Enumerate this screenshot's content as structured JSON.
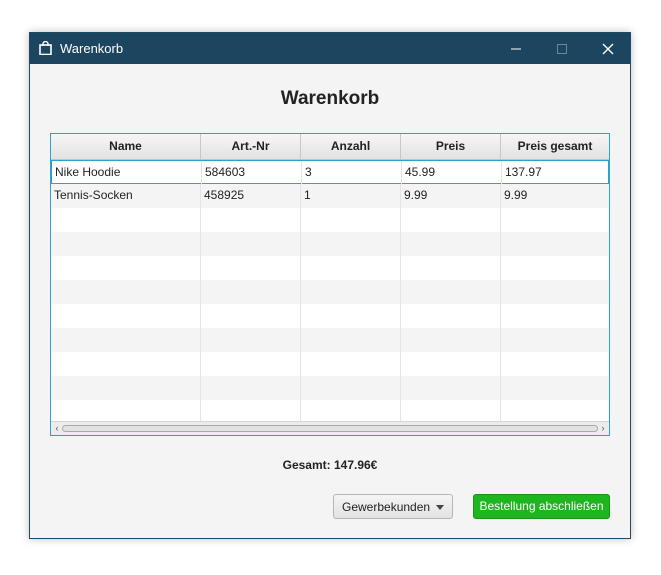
{
  "window": {
    "title": "Warenkorb",
    "app_icon": "shopping-bag-icon"
  },
  "heading": "Warenkorb",
  "table": {
    "columns": [
      "Name",
      "Art.-Nr",
      "Anzahl",
      "Preis",
      "Preis gesamt"
    ],
    "rows": [
      [
        "Nike Hoodie",
        "584603",
        "3",
        "45.99",
        "137.97"
      ],
      [
        "Tennis-Socken",
        "458925",
        "1",
        "9.99",
        "9.99"
      ]
    ]
  },
  "total": "Gesamt: 147.96€",
  "customer_type": {
    "selected": "Gewerbekunden"
  },
  "checkout_button": "Bestellung abschließen",
  "colors": {
    "titlebar": "#1c4560",
    "accent": "#2aa2cc",
    "submit": "#1fb51f"
  }
}
